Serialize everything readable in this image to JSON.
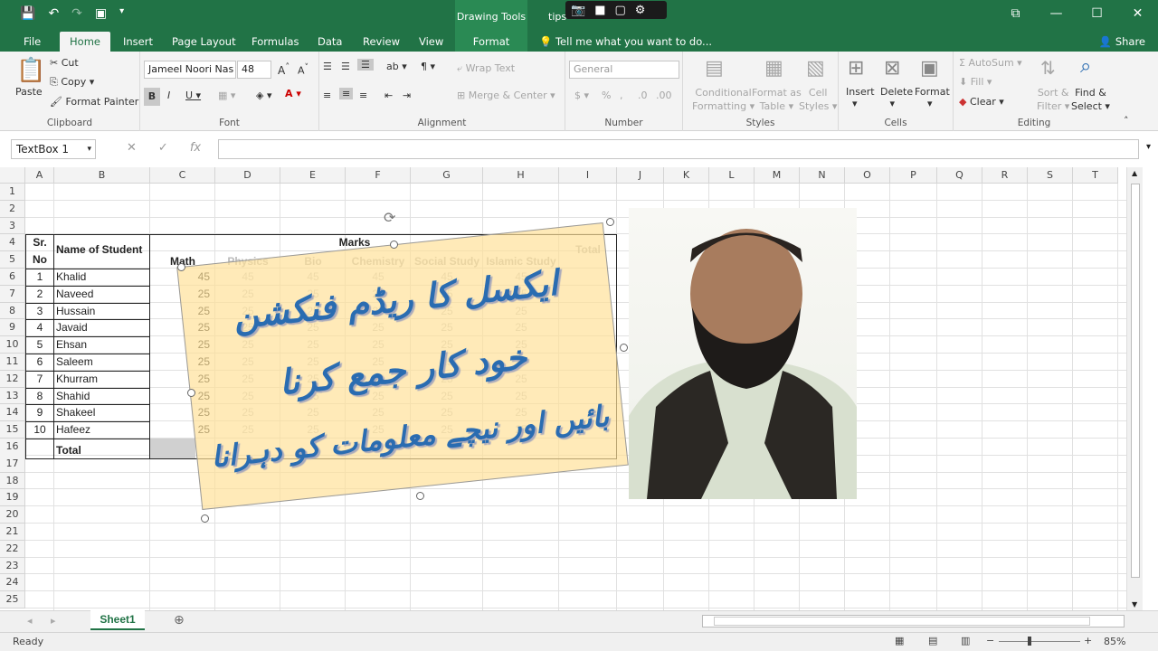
{
  "titlebar": {
    "drawing_tools": "Drawing Tools",
    "title": "tips"
  },
  "tabs": [
    "File",
    "Home",
    "Insert",
    "Page Layout",
    "Formulas",
    "Data",
    "Review",
    "View",
    "Format"
  ],
  "tellme": "Tell me what you want to do...",
  "share": "Share",
  "ribbon": {
    "clipboard": {
      "paste": "Paste",
      "cut": "Cut",
      "copy": "Copy",
      "format_painter": "Format Painter",
      "label": "Clipboard"
    },
    "font": {
      "name": "Jameel Noori Nas",
      "size": "48",
      "label": "Font"
    },
    "alignment": {
      "wrap": "Wrap Text",
      "merge": "Merge & Center",
      "label": "Alignment"
    },
    "number": {
      "format": "General",
      "label": "Number"
    },
    "styles": {
      "cond": "Conditional",
      "cond2": "Formatting",
      "table": "Format as",
      "table2": "Table",
      "cell": "Cell",
      "cell2": "Styles",
      "label": "Styles"
    },
    "cells": {
      "insert": "Insert",
      "delete": "Delete",
      "format": "Format",
      "label": "Cells"
    },
    "editing": {
      "autosum": "AutoSum",
      "fill": "Fill",
      "clear": "Clear",
      "sort": "Sort &",
      "sort2": "Filter",
      "find": "Find &",
      "find2": "Select",
      "label": "Editing"
    }
  },
  "namebox": "TextBox 1",
  "columns": [
    "A",
    "B",
    "C",
    "D",
    "E",
    "F",
    "G",
    "H",
    "I",
    "J",
    "K",
    "L",
    "M",
    "N",
    "O",
    "P",
    "Q",
    "R",
    "S",
    "T"
  ],
  "rows": [
    "1",
    "2",
    "3",
    "4",
    "5",
    "6",
    "7",
    "8",
    "9",
    "10",
    "11",
    "12",
    "13",
    "14",
    "15",
    "16",
    "17",
    "18",
    "19",
    "20",
    "21",
    "22",
    "23",
    "24",
    "25"
  ],
  "table": {
    "sr": "Sr.",
    "no": "No",
    "name_header": "Name of Student",
    "marks": "Marks",
    "total": "Total",
    "subjects": [
      "Math",
      "Physics",
      "Bio",
      "Chemistry",
      "Social Study",
      "Islamic Study"
    ],
    "students": [
      {
        "sr": "1",
        "name": "Khalid",
        "math": "45"
      },
      {
        "sr": "2",
        "name": "Naveed",
        "math": "25"
      },
      {
        "sr": "3",
        "name": "Hussain",
        "math": "25"
      },
      {
        "sr": "4",
        "name": "Javaid",
        "math": "25"
      },
      {
        "sr": "5",
        "name": "Ehsan",
        "math": "25"
      },
      {
        "sr": "6",
        "name": "Saleem",
        "math": "25"
      },
      {
        "sr": "7",
        "name": "Khurram",
        "math": "25"
      },
      {
        "sr": "8",
        "name": "Shahid",
        "math": "25"
      },
      {
        "sr": "9",
        "name": "Shakeel",
        "math": "25"
      },
      {
        "sr": "10",
        "name": "Hafeez",
        "math": "25"
      }
    ],
    "faded": [
      [
        "45",
        "45",
        "45",
        "45",
        "45"
      ],
      [
        "25",
        "25",
        "25",
        "25",
        "25"
      ],
      [
        "25",
        "25",
        "25",
        "25",
        "25"
      ],
      [
        "25",
        "25",
        "25",
        "25",
        "25"
      ],
      [
        "25",
        "25",
        "25",
        "25",
        "25"
      ],
      [
        "25",
        "25",
        "25",
        "25",
        "25"
      ],
      [
        "25",
        "25",
        "25",
        "25",
        "25"
      ],
      [
        "25",
        "25",
        "25",
        "25",
        "25"
      ],
      [
        "25",
        "25",
        "25",
        "25",
        "25"
      ],
      [
        "25",
        "25",
        "25",
        "25",
        "25"
      ]
    ],
    "total_row": "Total"
  },
  "textbox": {
    "line1": "ایکسل کا ریڈم فنکشن",
    "line2": "خود کار جمع کرنا",
    "line3": "بائیں اور نیچے معلومات کو دہرانا"
  },
  "sheet_tab": "Sheet1",
  "status": {
    "ready": "Ready",
    "zoom": "85%"
  }
}
